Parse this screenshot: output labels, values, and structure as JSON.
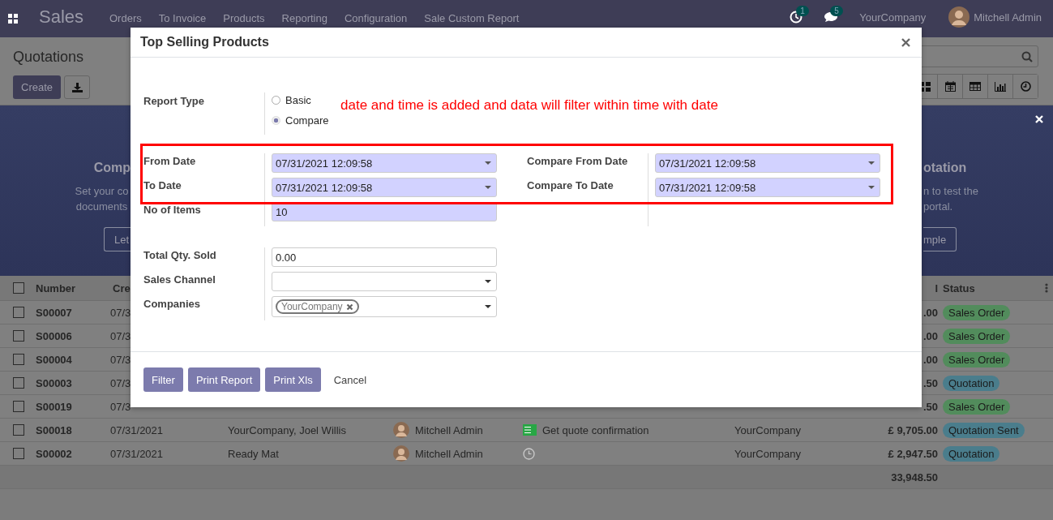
{
  "navbar": {
    "app": "Sales",
    "menu": [
      "Orders",
      "To Invoice",
      "Products",
      "Reporting",
      "Configuration",
      "Sale Custom Report"
    ],
    "activity_count": "1",
    "message_count": "5",
    "company": "YourCompany",
    "user": "Mitchell Admin"
  },
  "control_panel": {
    "title": "Quotations",
    "create_button": "Create"
  },
  "banner": {
    "left": {
      "title": "Comp",
      "lines": [
        "Set your co",
        "documents"
      ],
      "button": "Let"
    },
    "right": {
      "title": "otation",
      "lines": [
        "n to test the",
        "portal."
      ],
      "button": "mple"
    }
  },
  "table": {
    "header": {
      "all_checked": false,
      "number": "Number",
      "column_2": "Cre",
      "column_7": "l",
      "status": "Status"
    },
    "rows": [
      {
        "checked": false,
        "number": "S00007",
        "created": "07/3",
        "total": ".00",
        "status": "Sales Order",
        "color": "#528c5c"
      },
      {
        "checked": false,
        "number": "S00006",
        "created": "07/3",
        "total": ".00",
        "status": "Sales Order",
        "color": "#528c5c"
      },
      {
        "checked": false,
        "number": "S00004",
        "created": "07/3",
        "total": ".00",
        "status": "Sales Order",
        "color": "#528c5c"
      },
      {
        "checked": false,
        "number": "S00003",
        "created": "07/3",
        "total": ".50",
        "status": "Quotation",
        "color": "#4a7d8c"
      },
      {
        "checked": false,
        "number": "S00019",
        "created": "07/3",
        "total": ".50",
        "status": "Sales Order",
        "color": "#528c5c"
      },
      {
        "checked": false,
        "number": "S00018",
        "created": "07/31/2021",
        "customer": "YourCompany, Joel Willis",
        "salesperson": "Mitchell Admin",
        "activity": {
          "kind": "todo",
          "text": "Get quote confirmation"
        },
        "company": "YourCompany",
        "total": "£ 9,705.00",
        "status": "Quotation Sent",
        "color": "#4a7d8c"
      },
      {
        "checked": false,
        "number": "S00002",
        "created": "07/31/2021",
        "customer": "Ready Mat",
        "salesperson": "Mitchell Admin",
        "activity": {
          "kind": "none"
        },
        "company": "YourCompany",
        "total": "£ 2,947.50",
        "status": "Quotation",
        "color": "#4a7d8c"
      }
    ],
    "footer_total": "33,948.50"
  },
  "dialog": {
    "title": "Top Selling Products",
    "note": "date and time is added and data will filter within time with date",
    "report_type": {
      "label": "Report Type",
      "options": [
        {
          "label": "Basic",
          "selected": false
        },
        {
          "label": "Compare",
          "selected": true
        }
      ]
    },
    "group_1": [
      {
        "label": "From Date",
        "value": "07/31/2021 12:09:58",
        "kind": "date",
        "required": true
      },
      {
        "label": "To Date",
        "value": "07/31/2021 12:09:58",
        "kind": "date",
        "required": true
      },
      {
        "label": "No of Items",
        "value": "10",
        "kind": "text",
        "required": true
      }
    ],
    "compare_fields": [
      {
        "label": "Compare From Date",
        "value": "07/31/2021 12:09:58",
        "kind": "date",
        "required": true
      },
      {
        "label": "Compare To Date",
        "value": "07/31/2021 12:09:58",
        "kind": "date",
        "required": true
      }
    ],
    "group_2": [
      {
        "label": "Total Qty. Sold",
        "value": "0.00",
        "kind": "text",
        "required": false
      },
      {
        "label": "Sales Channel",
        "kind": "select",
        "required": false
      },
      {
        "label": "Companies",
        "kind": "tags",
        "tags": [
          "YourCompany"
        ],
        "required": false
      }
    ],
    "buttons": [
      {
        "label": "Filter",
        "kind": "primary"
      },
      {
        "label": "Print Report",
        "kind": "primary"
      },
      {
        "label": "Print Xls",
        "kind": "primary"
      },
      {
        "label": "Cancel",
        "kind": "link"
      }
    ]
  }
}
